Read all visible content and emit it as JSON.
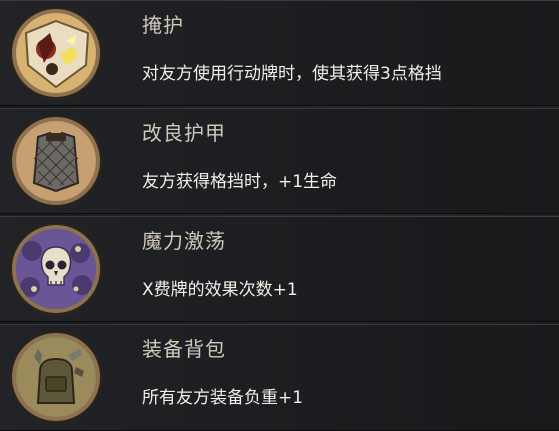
{
  "skills": [
    {
      "name": "掩护",
      "description": "对友方使用行动牌时，使其获得3点格挡",
      "icon": "warrior-shield-icon"
    },
    {
      "name": "改良护甲",
      "description": "友方获得格挡时，+1生命",
      "icon": "chainmail-armor-icon"
    },
    {
      "name": "魔力激荡",
      "description": "X费牌的效果次数+1",
      "icon": "skull-mana-icon"
    },
    {
      "name": "装备背包",
      "description": "所有友方装备负重+1",
      "icon": "backpack-gear-icon"
    }
  ],
  "colors": {
    "title": "#cfc8bb",
    "description": "#f1efe8",
    "icon_ring": "#8c7250"
  }
}
